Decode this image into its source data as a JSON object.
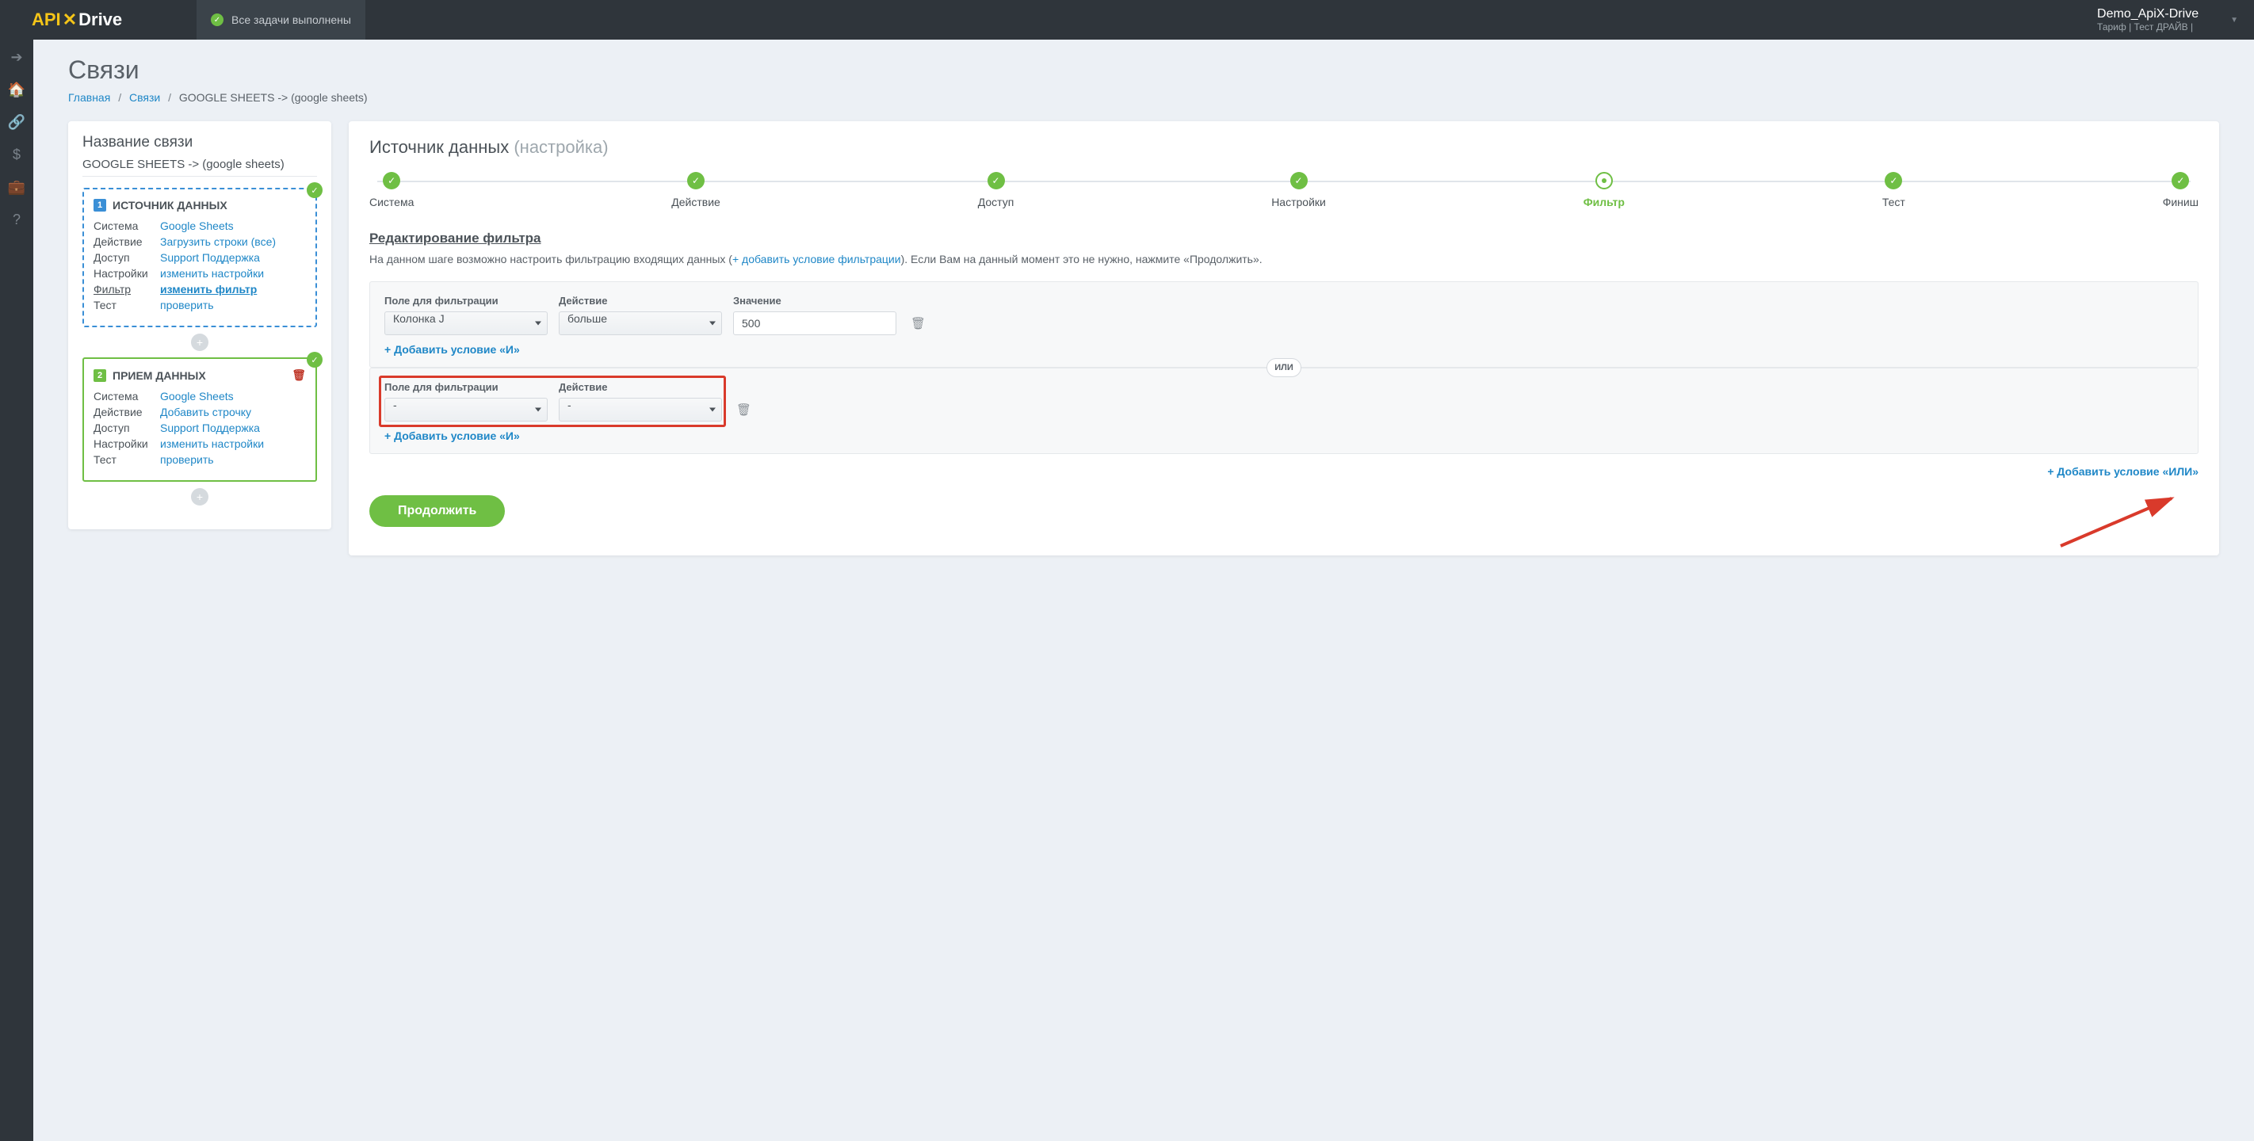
{
  "topbar": {
    "logo_part1": "API",
    "logo_part2": "Drive",
    "tasks_done": "Все задачи выполнены",
    "account_name": "Demo_ApiX-Drive",
    "tariff_label": "Тариф | Тест ДРАЙВ |"
  },
  "page": {
    "title": "Связи",
    "breadcrumbs": {
      "home": "Главная",
      "links": "Связи",
      "current": "GOOGLE SHEETS -> (google sheets)"
    }
  },
  "left": {
    "title": "Название связи",
    "conn_name": "GOOGLE SHEETS -> (google sheets)",
    "source": {
      "header": "ИСТОЧНИК ДАННЫХ",
      "num": "1",
      "rows": {
        "system_k": "Система",
        "system_v": "Google Sheets",
        "action_k": "Действие",
        "action_v": "Загрузить строки (все)",
        "access_k": "Доступ",
        "access_v": "Support Поддержка",
        "settings_k": "Настройки",
        "settings_v": "изменить настройки",
        "filter_k": "Фильтр",
        "filter_v": "изменить фильтр",
        "test_k": "Тест",
        "test_v": "проверить"
      }
    },
    "dest": {
      "header": "ПРИЕМ ДАННЫХ",
      "num": "2",
      "rows": {
        "system_k": "Система",
        "system_v": "Google Sheets",
        "action_k": "Действие",
        "action_v": "Добавить строчку",
        "access_k": "Доступ",
        "access_v": "Support Поддержка",
        "settings_k": "Настройки",
        "settings_v": "изменить настройки",
        "test_k": "Тест",
        "test_v": "проверить"
      }
    }
  },
  "right": {
    "title_main": "Источник данных",
    "title_sub": "(настройка)",
    "steps": {
      "system": "Система",
      "action": "Действие",
      "access": "Доступ",
      "settings": "Настройки",
      "filter": "Фильтр",
      "test": "Тест",
      "finish": "Финиш"
    },
    "section_title": "Редактирование фильтра",
    "description_pre": "На данном шаге возможно настроить фильтрацию входящих данных (",
    "description_link": "+ добавить условие фильтрации",
    "description_post": "). Если Вам на данный момент это не нужно, нажмите «Продолжить».",
    "labels": {
      "field": "Поле для фильтрации",
      "action": "Действие",
      "value": "Значение"
    },
    "group1": {
      "field_value": "Колонка J",
      "action_value": "больше",
      "value": "500"
    },
    "group2": {
      "field_value": "-",
      "action_value": "-"
    },
    "or_label": "ИЛИ",
    "add_and": "Добавить условие «И»",
    "add_or_pre": "Добавить условие «",
    "add_or_strong": "ИЛИ",
    "add_or_post": "»",
    "continue": "Продолжить"
  }
}
